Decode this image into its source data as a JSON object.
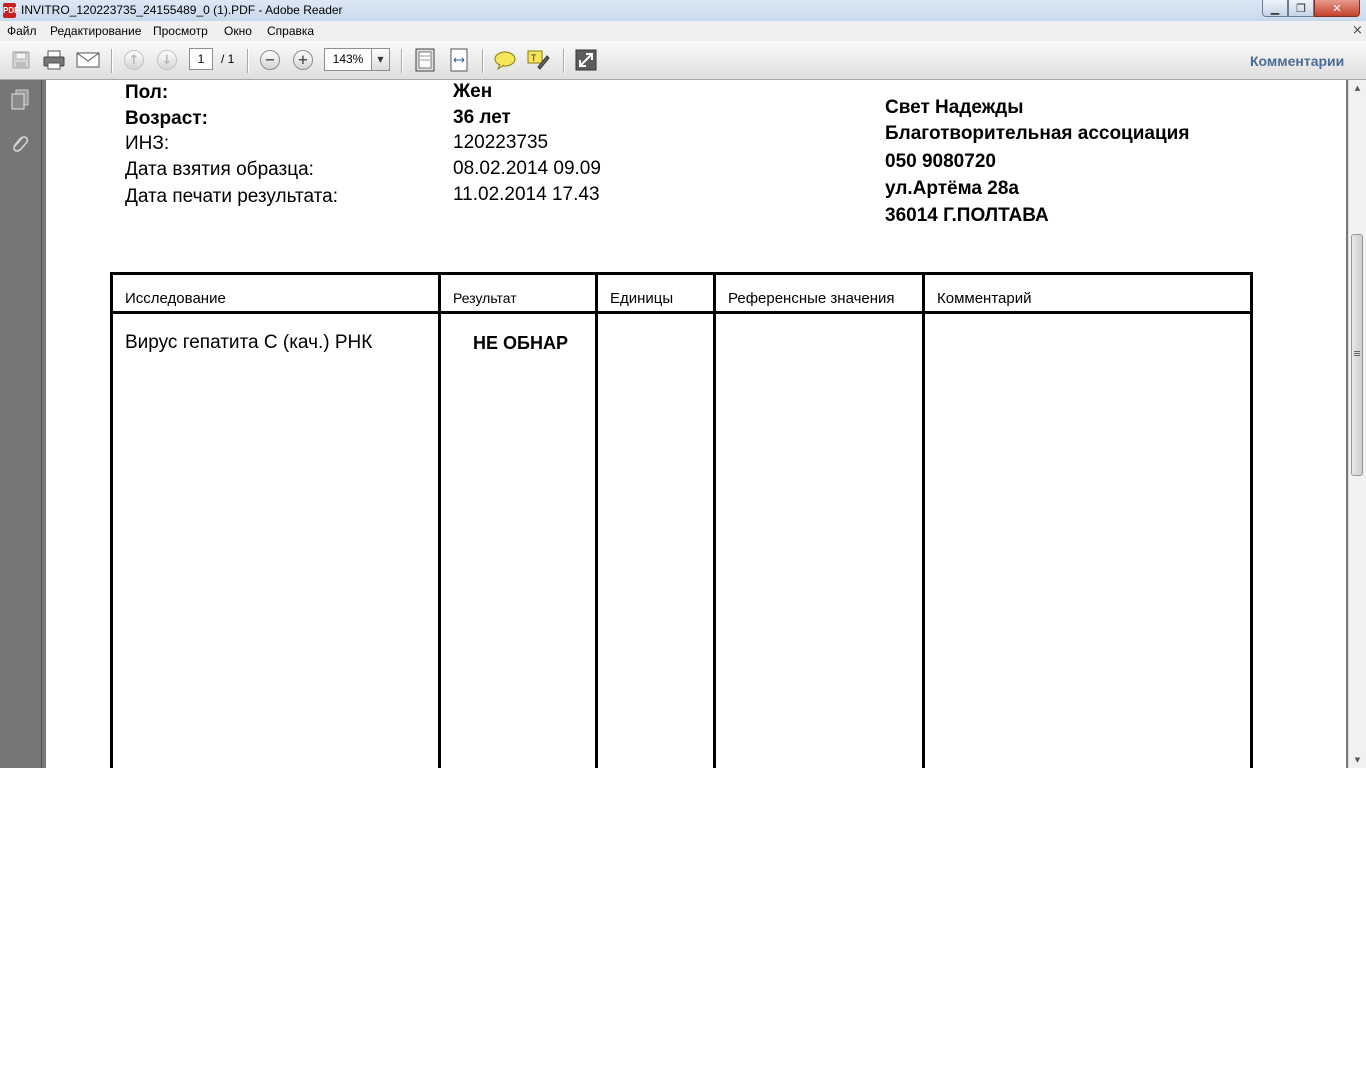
{
  "window": {
    "title": "INVITRO_120223735_24155489_0 (1).PDF - Adobe Reader",
    "app_icon_label": "PDF",
    "minimize": "▁",
    "maximize": "❐",
    "close": "✕"
  },
  "menu": {
    "items": [
      "Файл",
      "Редактирование",
      "Просмотр",
      "Окно",
      "Справка"
    ],
    "close_glyph": "×"
  },
  "toolbar": {
    "page_current": "1",
    "page_total": "/ 1",
    "zoom": "143%",
    "comments_label": "Комментарии"
  },
  "patient": {
    "sex_label": "Пол:",
    "sex_value": "Жен",
    "age_label": "Возраст:",
    "age_value": "36 лет",
    "inz_label": "ИНЗ:",
    "inz_value": "120223735",
    "sample_date_label": "Дата взятия образца:",
    "sample_date_value": "08.02.2014 09.09",
    "print_date_label": "Дата печати результата:",
    "print_date_value": "11.02.2014 17.43"
  },
  "organization": {
    "line1": "Свет Надежды",
    "line2": "Благотворительная ассоциация",
    "phone": "050 9080720",
    "street": "ул.Артёма 28а",
    "city": "36014 Г.ПОЛТАВА"
  },
  "table": {
    "headers": {
      "study": "Исследование",
      "result": "Результат",
      "units": "Единицы",
      "reference": "Референсные значения",
      "comment": "Комментарий"
    },
    "rows": [
      {
        "study": "Вирус гепатита С (кач.) РНК",
        "result": "НЕ ОБНАР",
        "units": "",
        "reference": "",
        "comment": ""
      }
    ]
  }
}
